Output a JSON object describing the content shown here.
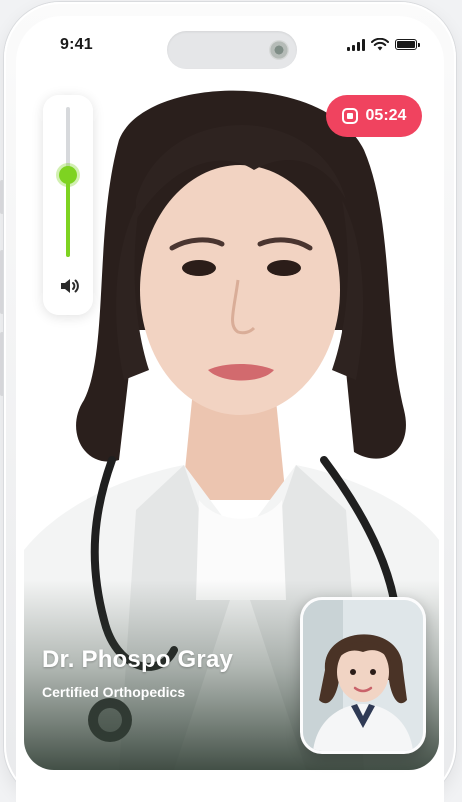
{
  "status_bar": {
    "time": "9:41"
  },
  "call": {
    "recording_time": "05:24",
    "volume_level": 0.55,
    "doctor_name": "Dr. Phospo Gray",
    "doctor_specialty": "Certified Orthopedics"
  },
  "icons": {
    "record": "record-stop-icon",
    "volume": "speaker-icon",
    "signal": "cellular-signal-icon",
    "wifi": "wifi-icon",
    "battery": "battery-icon"
  },
  "colors": {
    "accent_green": "#7ed321",
    "record_red": "#f0435f"
  }
}
